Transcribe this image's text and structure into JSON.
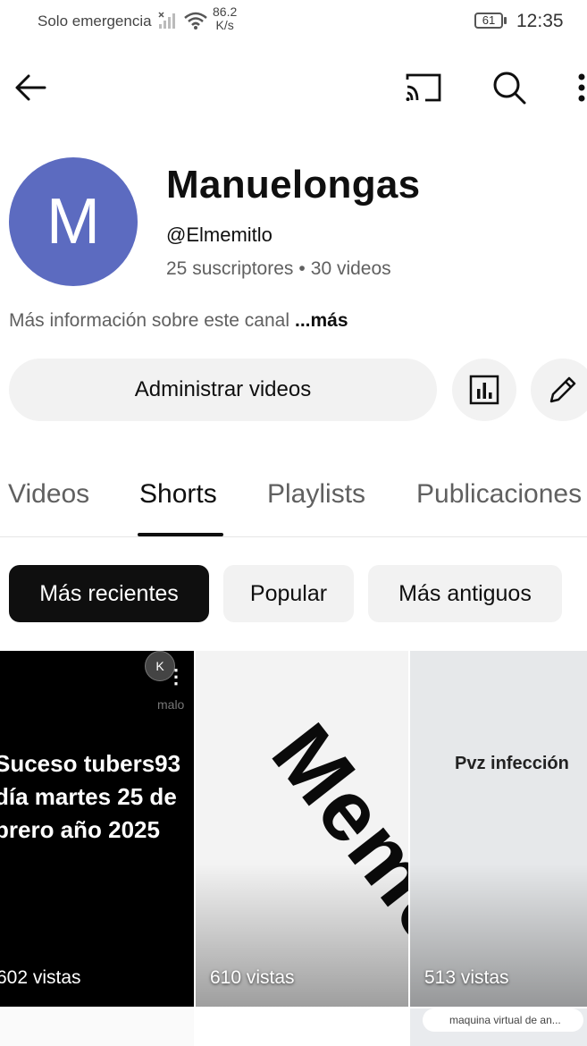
{
  "status_bar": {
    "carrier": "Solo emergencia",
    "speed_value": "86.2",
    "speed_unit": "K/s",
    "battery": "61",
    "time": "12:35"
  },
  "channel": {
    "avatar_letter": "M",
    "avatar_color": "#5c6bc0",
    "name": "Manuelongas",
    "handle": "@Elmemitlo",
    "subscribers": "25 suscriptores",
    "videos": "30 videos",
    "stats_separator": "•",
    "description": "Más información sobre este canal",
    "more_label": "...más"
  },
  "actions": {
    "manage_label": "Administrar videos"
  },
  "tabs": [
    {
      "label": "Videos"
    },
    {
      "label": "Shorts",
      "active": true
    },
    {
      "label": "Playlists"
    },
    {
      "label": "Publicaciones"
    }
  ],
  "chips": [
    {
      "label": "Más recientes",
      "selected": true
    },
    {
      "label": "Popular"
    },
    {
      "label": "Más antiguos"
    }
  ],
  "shorts": [
    {
      "overlay_line1": "Suceso tubers93",
      "overlay_line2": "día martes 25 de",
      "overlay_line3": "brero año 2025",
      "watermark": "malo",
      "logo_letter": "K",
      "menu": "⋮",
      "views": "602 vistas"
    },
    {
      "overlay": "Memes",
      "views": "610 vistas"
    },
    {
      "overlay": "Pvz infección",
      "views": "513 vistas"
    }
  ],
  "next_row": {
    "search_hint": "maquina virtual de an..."
  }
}
